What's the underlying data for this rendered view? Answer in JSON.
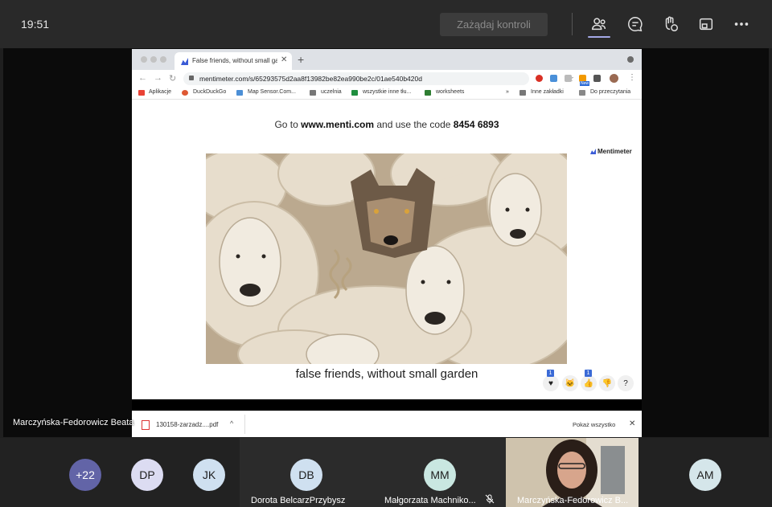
{
  "topbar": {
    "time": "19:51",
    "request_control_label": "Zażądaj kontroli",
    "icons": [
      "people-icon",
      "chat-icon",
      "reactions-icon",
      "share-tray-icon",
      "more-icon"
    ]
  },
  "browser": {
    "tab_title": "False friends, without small garden",
    "url": "mentimeter.com/s/65293575d2aa8f13982be82ea990be2c/01ae540b420d",
    "bookmarks": [
      "Aplikacje",
      "DuckDuckGo",
      "Map Sensor.Com...",
      "uczelnia",
      "wszystkie inne tłu...",
      "worksheets",
      "»",
      "Inne zakładki",
      "Do przeczytania"
    ],
    "new_badge": "New"
  },
  "slide": {
    "goto_prefix": "Go to ",
    "goto_site": "www.menti.com",
    "goto_middle": " and use the code ",
    "goto_code": "8454 6893",
    "brand": "Mentimeter",
    "question": "false friends, without small garden",
    "reactions": [
      {
        "icon": "heart-icon",
        "glyph": "♥",
        "count": "1"
      },
      {
        "icon": "cat-icon",
        "glyph": "🐱",
        "count": ""
      },
      {
        "icon": "thumbs-up-icon",
        "glyph": "👍",
        "count": "1"
      },
      {
        "icon": "thumbs-down-icon",
        "glyph": "👎",
        "count": ""
      },
      {
        "icon": "question-icon",
        "glyph": "?",
        "count": ""
      }
    ]
  },
  "downloads": {
    "file": "130158-zarzadz....pdf",
    "show_all": "Pokaż wszystko"
  },
  "presenter_label": "Marczyńska-Fedorowicz Beata",
  "participants": [
    {
      "initials": "+22",
      "color": "#6264a7",
      "name": ""
    },
    {
      "initials": "DP",
      "color": "#dcdcf2",
      "name": ""
    },
    {
      "initials": "JK",
      "color": "#cfe0f0",
      "name": ""
    },
    {
      "initials": "DB",
      "color": "#cfe0f0",
      "name": "Dorota BelcarzPrzybysz"
    },
    {
      "initials": "MM",
      "color": "#c9e7e1",
      "name": "Małgorzata Machniko..."
    },
    {
      "initials": "",
      "color": "",
      "name": "Marczyńska-Fedorowicz B..."
    },
    {
      "initials": "AM",
      "color": "#d5e6ea",
      "name": ""
    }
  ]
}
